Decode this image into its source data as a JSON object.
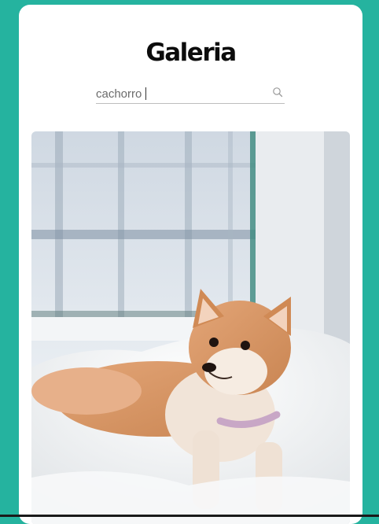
{
  "header": {
    "title": "Galeria"
  },
  "search": {
    "value": "cachorro",
    "icon": "search-icon"
  },
  "gallery": {
    "items": [
      {
        "subject": "shiba-inu-puppy-photo"
      }
    ]
  },
  "colors": {
    "background": "#25b39f",
    "card": "#ffffff",
    "title": "#0c0c0c"
  }
}
